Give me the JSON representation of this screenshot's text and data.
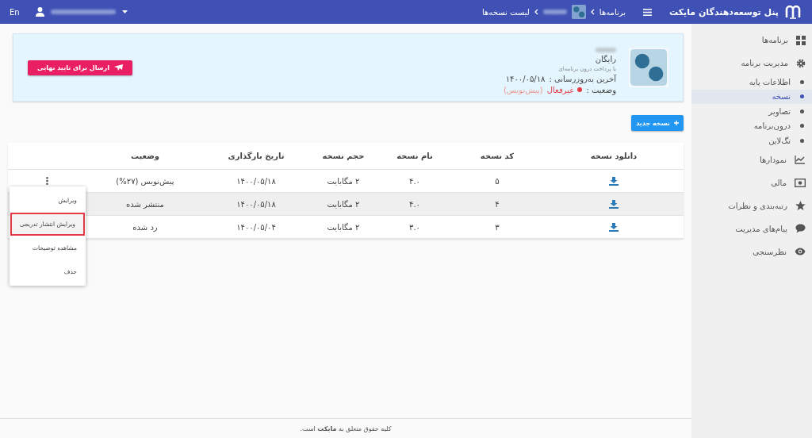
{
  "topbar": {
    "title": "پنل توسعه‌دهندگان مایکت",
    "language": "En",
    "breadcrumb": [
      {
        "kind": "link",
        "label": "برنامه‌ها"
      },
      {
        "kind": "app"
      },
      {
        "kind": "current",
        "label": "لیست نسخه‌ها"
      }
    ]
  },
  "sidebar": {
    "items": [
      {
        "label": "برنامه‌ها",
        "selected": false
      },
      {
        "label": "مدیریت برنامه",
        "selected": false,
        "expanded": true,
        "children": [
          {
            "label": "اطلاعات پایه",
            "selected": false
          },
          {
            "label": "نسخه",
            "selected": true
          },
          {
            "label": "تصاویر",
            "selected": false
          },
          {
            "label": "درون‌برنامه",
            "selected": false
          },
          {
            "label": "تگ‌لاین",
            "selected": false
          }
        ]
      },
      {
        "label": "نمودارها",
        "selected": false
      },
      {
        "label": "مالی",
        "selected": false
      },
      {
        "label": "رتبه‌بندی و نظرات",
        "selected": false
      },
      {
        "label": "پیام‌های مدیریت",
        "selected": false
      },
      {
        "label": "نظرسنجی",
        "selected": false
      }
    ]
  },
  "app_card": {
    "price": "رایگان",
    "price_note": "با پرداخت درون برنامه‌ای",
    "updated_label": "آخرین به‌روزرسانی :",
    "updated_value": "۱۴۰۰/۰۵/۱۸",
    "status_label": "وضعیت :",
    "status_value": "غیرفعال",
    "status_note": "(پیش‌نویس)",
    "submit_button": "ارسال برای تایید نهایی"
  },
  "new_version_button": "نسخه جدید",
  "table": {
    "columns": [
      "دانلود نسخه",
      "کد نسخه",
      "نام نسخه",
      "حجم نسخه",
      "تاریخ بارگذاری",
      "وضعیت"
    ],
    "rows": [
      {
        "code": "۵",
        "name": "۴.۰",
        "size": "۲ مگابایت",
        "date": "۱۴۰۰/۰۵/۱۸",
        "status": "پیش‌نویس (۲۷%)",
        "selected": false,
        "menu_open": true
      },
      {
        "code": "۴",
        "name": "۴.۰",
        "size": "۲ مگابایت",
        "date": "۱۴۰۰/۰۵/۱۸",
        "status": "منتشر شده",
        "selected": true,
        "menu_open": false
      },
      {
        "code": "۳",
        "name": "۳.۰",
        "size": "۲ مگابایت",
        "date": "۱۴۰۰/۰۵/۰۴",
        "status": "رد شده",
        "selected": false,
        "menu_open": false
      }
    ],
    "menu": [
      {
        "label": "ویرایش",
        "selected": false
      },
      {
        "label": "ویرایش انتشار تدریجی",
        "selected": true
      },
      {
        "label": "مشاهده توضیحات",
        "selected": false
      },
      {
        "label": "حذف",
        "selected": false
      }
    ]
  },
  "footer": "کلیه حقوق متعلق به **مایکت** است."
}
